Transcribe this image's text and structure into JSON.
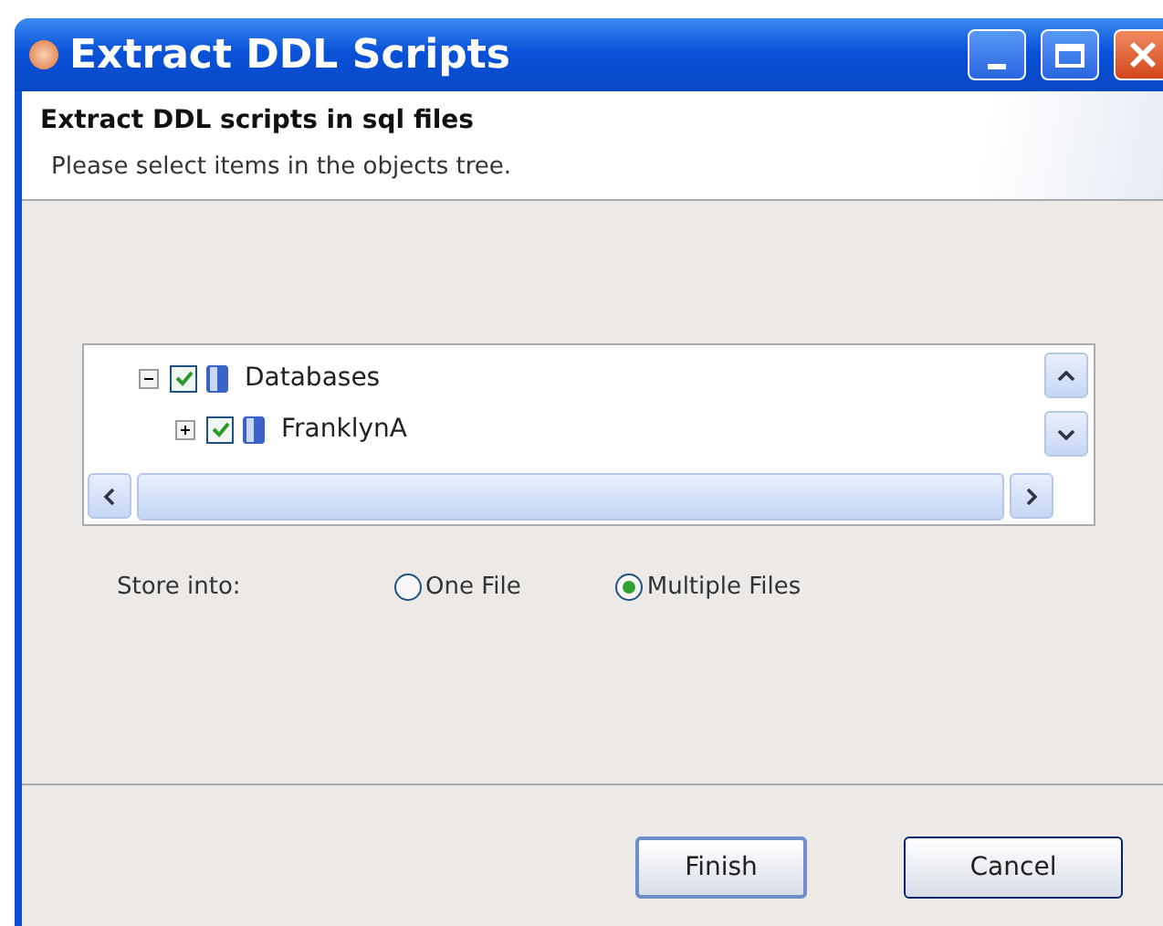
{
  "window": {
    "title": "Extract DDL Scripts"
  },
  "header": {
    "title": "Extract DDL scripts in sql files",
    "description": "Please select items in the objects tree."
  },
  "tree": [
    {
      "label": "Databases",
      "checked": true,
      "expanded": true,
      "children": [
        {
          "label": "FranklynA",
          "checked": true,
          "expanded": false
        }
      ]
    }
  ],
  "store_into": {
    "label": "Store into:",
    "options": [
      {
        "label": "One File",
        "selected": false
      },
      {
        "label": "Multiple Files",
        "selected": true
      }
    ]
  },
  "buttons": [
    {
      "label": "Finish",
      "default": true
    },
    {
      "label": "Cancel",
      "default": false
    }
  ]
}
